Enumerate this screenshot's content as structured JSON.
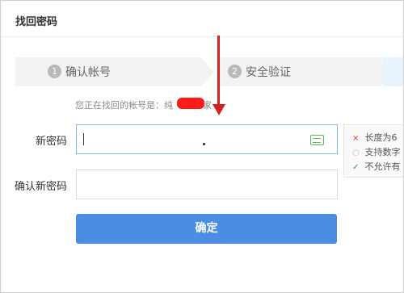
{
  "header": {
    "title": "找回密码"
  },
  "steps": [
    {
      "num": "1",
      "label": "确认帐号"
    },
    {
      "num": "2",
      "label": "安全验证"
    }
  ],
  "hint": {
    "prefix": "您正在找回的帐号是：纯",
    "suffix": "家"
  },
  "form": {
    "new_password_label": "新密码",
    "confirm_password_label": "确认新密码",
    "submit_label": "确定"
  },
  "tips": [
    {
      "icon": "×",
      "text": "长度为6"
    },
    {
      "icon": "○",
      "text": "支持数字"
    },
    {
      "icon": "✓",
      "text": "不允许有"
    }
  ],
  "colors": {
    "primary": "#4a8de3",
    "annotation_arrow": "#d32020",
    "redaction": "#ff1a1a"
  }
}
